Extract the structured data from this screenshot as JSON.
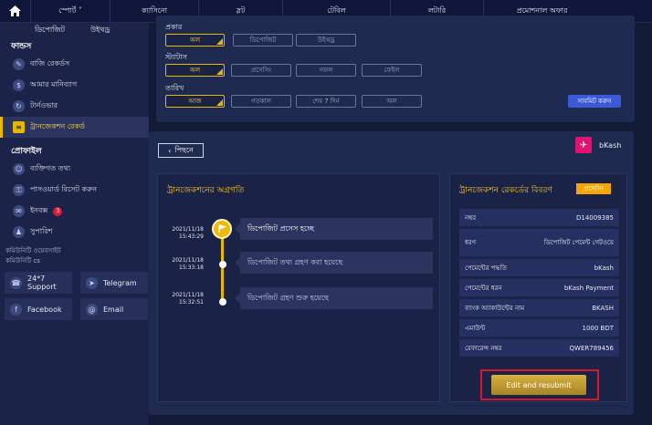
{
  "nav": {
    "items": [
      "স্পোর্ট ˅",
      "ক্যাসিনো",
      "স্লট",
      "টেবিল",
      "লটারি",
      "প্রমোশনাল অফার"
    ]
  },
  "sidebar": {
    "tabs": [
      "ডিপোজিট",
      "উইথড্র"
    ],
    "funds_heading": "ফান্ডস",
    "funds_items": [
      {
        "label": "বাজি রেকর্ডস",
        "icon": "bet-record-icon"
      },
      {
        "label": "আমার মানিব্যাগ",
        "icon": "wallet-icon"
      },
      {
        "label": "টার্নওভার",
        "icon": "turnover-icon"
      },
      {
        "label": "ট্রানজেকশন রেকর্ড",
        "icon": "transaction-record-icon"
      }
    ],
    "profile_heading": "প্রোফাইল",
    "profile_items": [
      {
        "label": "ব্যক্তিগত তথ্য",
        "icon": "user-icon"
      },
      {
        "label": "পাসওয়ার্ড রিসেট করুন",
        "icon": "lock-icon"
      },
      {
        "label": "ইনবক্স",
        "icon": "inbox-icon",
        "badge": "3"
      },
      {
        "label": "সুপারিশ",
        "icon": "referral-icon"
      }
    ],
    "community_lines": [
      "কমিউনিটি ওয়েবসাইট",
      "কমিউনিটি cs"
    ],
    "contacts": [
      {
        "label": "24*7\nSupport",
        "icon": "support-icon"
      },
      {
        "label": "Telegram",
        "icon": "telegram-icon"
      },
      {
        "label": "Facebook",
        "icon": "facebook-icon"
      },
      {
        "label": "Email",
        "icon": "email-icon"
      }
    ]
  },
  "filters": {
    "type_label": "প্রকার",
    "type_options": [
      "অল",
      "ডিপোজিট",
      "উইথড্র"
    ],
    "status_label": "স্ট্যাটাস",
    "status_options": [
      "অল",
      "প্রসেসিং",
      "সফল",
      "ফেইল"
    ],
    "date_label": "তারিখ",
    "date_options": [
      "আজ",
      "গতকাল",
      "শেষ 7 দিন",
      "অল"
    ],
    "submit_label": "সাবমিট করুন"
  },
  "detail": {
    "back_label": "পিছনে",
    "method_name": "bKash",
    "progress_title": "ট্রানজেকশনের অগ্রগতি",
    "timeline": [
      {
        "date": "2021/11/18",
        "time": "15:43:29",
        "text": "ডিপোজিট প্রসেস হচ্ছে"
      },
      {
        "date": "2021/11/18",
        "time": "15:33:18",
        "text": "ডিপোজিট তথ্য গ্রহণ করা হয়েছে"
      },
      {
        "date": "2021/11/18",
        "time": "15:32:51",
        "text": "ডিপোজিট গ্রহণ শুরু হয়েছে"
      }
    ],
    "record_title": "ট্রানজেকশন রেকর্ডের বিবরণ",
    "status_tag": "প্রসেসিং",
    "rows": [
      {
        "label": "নম্বর",
        "value": "D14009385"
      },
      {
        "label": "ধরণ",
        "value": "ডিপোজিট পেমেন্ট গেটওয়ে"
      },
      {
        "label": "পেমেন্টের পদ্ধতি",
        "value": "bKash"
      },
      {
        "label": "পেমেন্টের ধরন",
        "value": "bKash Payment"
      },
      {
        "label": "ব্যাংক অ্যাকাউন্টের নাম",
        "value": "BKASH"
      },
      {
        "label": "এমাউন্ট",
        "value": "1000 BDT"
      },
      {
        "label": "রেফারেন্স নম্বর",
        "value": "QWER789456"
      }
    ],
    "resubmit_label": "Edit and resubmit"
  }
}
